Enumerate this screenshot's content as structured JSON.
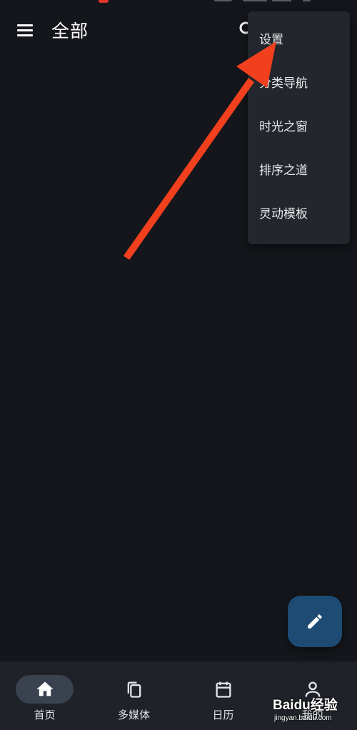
{
  "app_bar": {
    "title": "全部",
    "menu_icon": "hamburger-menu-icon",
    "search_icon": "search-icon"
  },
  "overflow_menu": {
    "items": [
      {
        "label": "设置"
      },
      {
        "label": "分类导航"
      },
      {
        "label": "时光之窗"
      },
      {
        "label": "排序之道"
      },
      {
        "label": "灵动模板"
      }
    ]
  },
  "fab": {
    "icon": "pencil-edit-icon"
  },
  "bottom_nav": {
    "items": [
      {
        "label": "首页",
        "icon": "home-icon",
        "active": true
      },
      {
        "label": "多媒体",
        "icon": "copy-files-icon",
        "active": false
      },
      {
        "label": "日历",
        "icon": "calendar-icon",
        "active": false
      },
      {
        "label": "我的",
        "icon": "person-icon",
        "active": false
      }
    ]
  },
  "watermark": {
    "brand": "Baidu经验",
    "url": "jingyan.baidu.com"
  },
  "colors": {
    "background": "#14161b",
    "menu_background": "#23262c",
    "fab_background": "#1d4b73",
    "nav_background": "#1f2228",
    "nav_active_pill": "#3a4250",
    "annotation_arrow": "#f2401f"
  }
}
